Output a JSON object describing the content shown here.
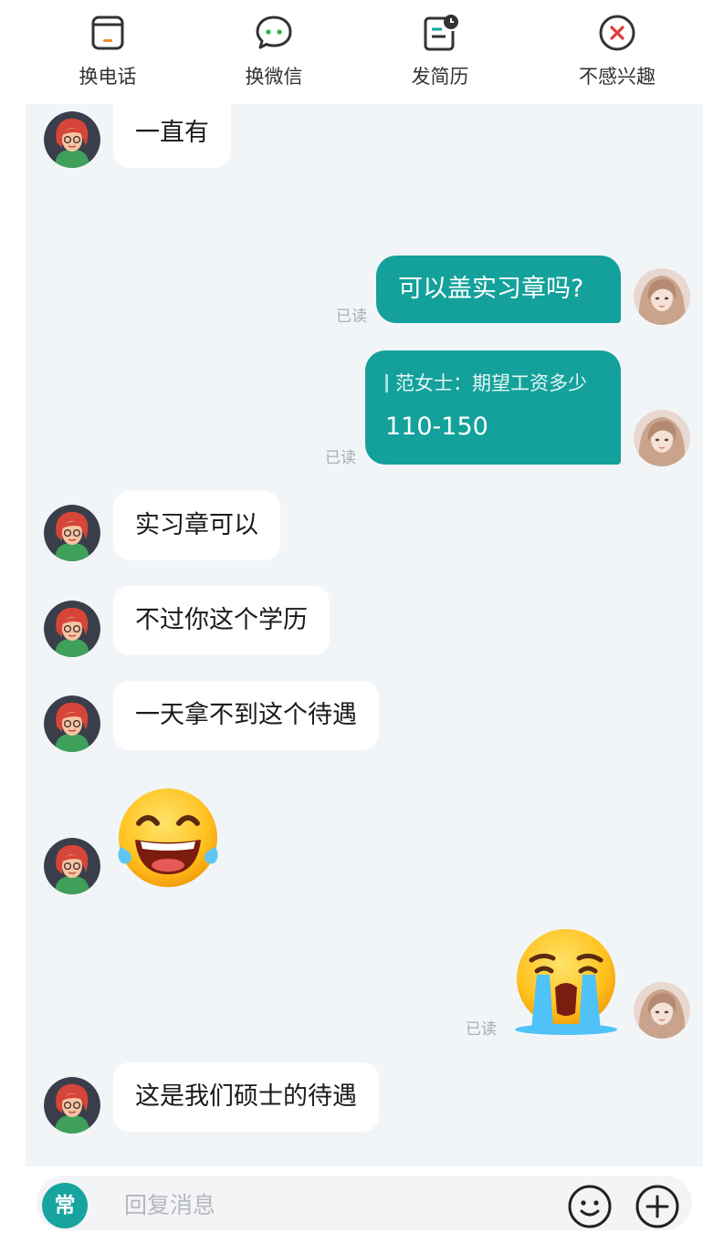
{
  "actions": [
    {
      "label": "换电话",
      "icon": "phone-swap-icon"
    },
    {
      "label": "换微信",
      "icon": "wechat-icon"
    },
    {
      "label": "发简历",
      "icon": "resume-icon"
    },
    {
      "label": "不感兴趣",
      "icon": "close-circle-icon"
    }
  ],
  "messages": {
    "m1": "一直有",
    "m2": "可以盖实习章吗?",
    "m3_quote": "范女士：期望工资多少",
    "m3": "110-150",
    "m4": "实习章可以",
    "m5": "不过你这个学历",
    "m6": "一天拿不到这个待遇",
    "m7_emoji": "laughing-tears-emoji",
    "m8_emoji": "crying-emoji",
    "m9": "这是我们硕士的待遇"
  },
  "read_label": "已读",
  "input": {
    "common_label": "常",
    "placeholder": "回复消息"
  },
  "colors": {
    "accent": "#14a19b",
    "background": "#f2f5f8",
    "bubble_in": "#ffffff"
  }
}
